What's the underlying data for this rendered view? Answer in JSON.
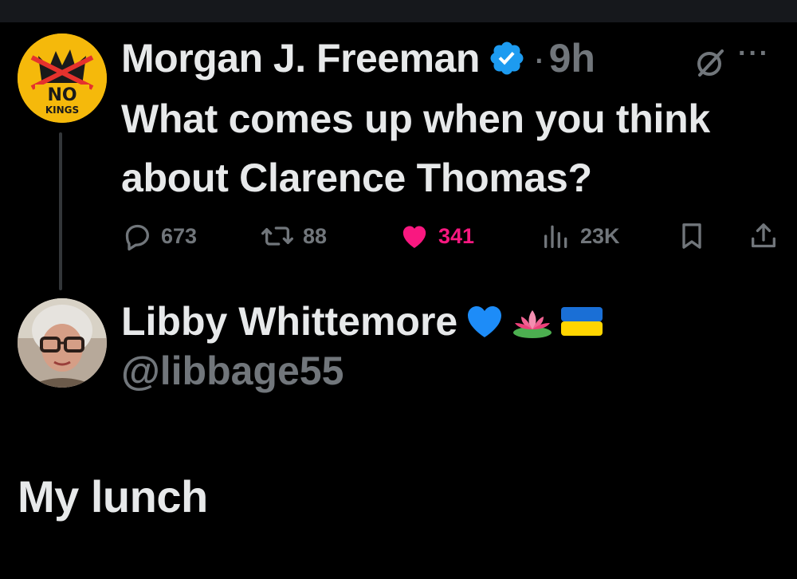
{
  "tweet": {
    "author_name": "Morgan J. Freeman",
    "time_sep": "·",
    "time": "9h",
    "more_label": "···",
    "text": "What comes up when you think about Clarence Thomas?",
    "avatar_text_top": "NO",
    "avatar_text_bottom": "KINGS",
    "stats": {
      "replies": "673",
      "reposts": "88",
      "likes": "341",
      "views": "23K"
    },
    "colors": {
      "like": "#f91880",
      "verified": "#1d9bf0",
      "muted": "#71767b"
    }
  },
  "reply": {
    "author_name": "Libby Whittemore",
    "name_emojis": [
      "blue-heart-icon",
      "lotus-icon",
      "ukraine-flag-icon"
    ],
    "handle": "@libbage55",
    "text": "My lunch"
  }
}
